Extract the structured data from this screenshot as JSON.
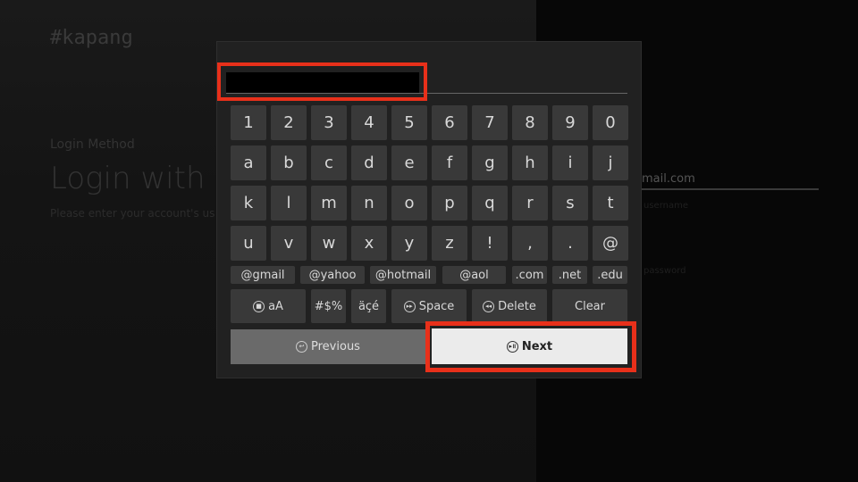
{
  "app": {
    "logo": "#kapang"
  },
  "login": {
    "method_label": "Login Method",
    "title": "Login with y",
    "description": "Please enter your account's us login.",
    "email_value": "mail.com",
    "username_label": "username",
    "password_label": "password"
  },
  "keyboard": {
    "rows": [
      [
        "1",
        "2",
        "3",
        "4",
        "5",
        "6",
        "7",
        "8",
        "9",
        "0"
      ],
      [
        "a",
        "b",
        "c",
        "d",
        "e",
        "f",
        "g",
        "h",
        "i",
        "j"
      ],
      [
        "k",
        "l",
        "m",
        "n",
        "o",
        "p",
        "q",
        "r",
        "s",
        "t"
      ],
      [
        "u",
        "v",
        "w",
        "x",
        "y",
        "z",
        "!",
        ",",
        ".",
        "@"
      ]
    ],
    "domains": [
      "@gmail",
      "@yahoo",
      "@hotmail",
      "@aol",
      ".com",
      ".net",
      ".edu"
    ],
    "functions": {
      "case": "aA",
      "symbols": "#$%",
      "accents": "äçé",
      "space": "Space",
      "delete": "Delete",
      "clear": "Clear"
    },
    "previous": "Previous",
    "next": "Next"
  },
  "colors": {
    "highlight": "#e8301a"
  }
}
